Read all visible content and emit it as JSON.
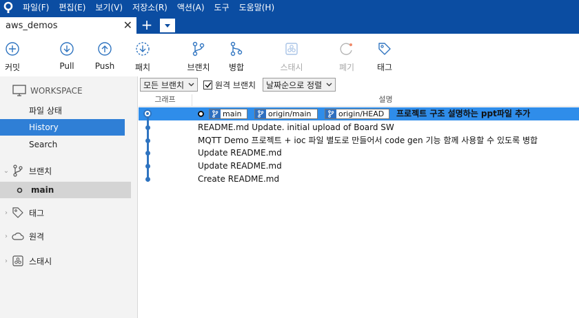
{
  "menubar": {
    "items": [
      "파일(F)",
      "편집(E)",
      "보기(V)",
      "저장소(R)",
      "액션(A)",
      "도구",
      "도움말(H)"
    ]
  },
  "tabs": {
    "active": "aws_demos",
    "close": "✕",
    "add": "+"
  },
  "toolbar": {
    "commit": "커밋",
    "pull": "Pull",
    "push": "Push",
    "fetch": "패치",
    "branch": "브랜치",
    "merge": "병합",
    "stash": "스태시",
    "discard": "폐기",
    "tag": "태그"
  },
  "sidebar": {
    "workspace": "WORKSPACE",
    "file_status": "파일 상태",
    "history": "History",
    "search": "Search",
    "branches": "브랜치",
    "branch_main": "main",
    "tags": "태그",
    "remotes": "원격",
    "stashes": "스태시"
  },
  "filter": {
    "branches_dropdown": "모든 브랜치",
    "remote_branches_label": "원격 브랜치",
    "remote_branches_checked": true,
    "sort_dropdown": "날짜순으로 정렬"
  },
  "columns": {
    "graph": "그래프",
    "description": "설명"
  },
  "commits": [
    {
      "message": "프로젝트 구조 설명하는 ppt파일 추가",
      "refs": [
        "main",
        "origin/main",
        "origin/HEAD"
      ],
      "selected": true
    },
    {
      "message": "README.md Update.  initial upload of Board SW"
    },
    {
      "message": "MQTT Demo 프로젝트 + ioc 파일 별도로 만들어서 code gen 기능 함께 사용할 수 있도록 병합"
    },
    {
      "message": "Update README.md"
    },
    {
      "message": "Update README.md"
    },
    {
      "message": "Create README.md"
    }
  ],
  "colors": {
    "titlebar": "#0b4da2",
    "selection": "#2f8dea",
    "sidebar_selection": "#2f7fd6",
    "graph": "#2f74c0"
  }
}
